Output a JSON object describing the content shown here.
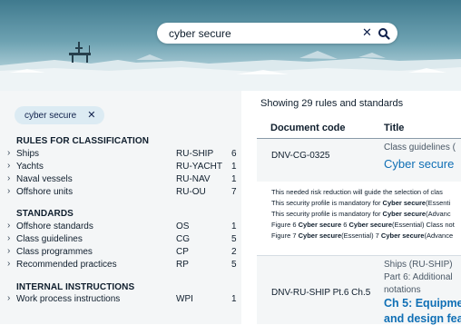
{
  "search": {
    "value": "cyber secure"
  },
  "chip": {
    "label": "cyber secure"
  },
  "groups": [
    {
      "title": "RULES FOR CLASSIFICATION",
      "items": [
        {
          "label": "Ships",
          "code": "RU-SHIP",
          "count": "6"
        },
        {
          "label": "Yachts",
          "code": "RU-YACHT",
          "count": "1"
        },
        {
          "label": "Naval vessels",
          "code": "RU-NAV",
          "count": "1"
        },
        {
          "label": "Offshore units",
          "code": "RU-OU",
          "count": "7"
        }
      ]
    },
    {
      "title": "STANDARDS",
      "items": [
        {
          "label": "Offshore standards",
          "code": "OS",
          "count": "1"
        },
        {
          "label": "Class guidelines",
          "code": "CG",
          "count": "5"
        },
        {
          "label": "Class programmes",
          "code": "CP",
          "count": "2"
        },
        {
          "label": "Recommended practices",
          "code": "RP",
          "count": "5"
        }
      ]
    },
    {
      "title": "INTERNAL INSTRUCTIONS",
      "items": [
        {
          "label": "Work process instructions",
          "code": "WPI",
          "count": "1"
        }
      ]
    }
  ],
  "results": {
    "showing": "Showing 29 rules and standards",
    "col_code": "Document code",
    "col_title": "Title",
    "r1": {
      "code": "DNV-CG-0325",
      "category": "Class guidelines (",
      "title": "Cyber secure",
      "snippets": [
        [
          "This needed risk reduction will guide the selection of clas",
          "",
          "",
          "",
          ""
        ],
        [
          "This security profile is mandatory for ",
          "Cyber secure",
          "(Essenti",
          "",
          ""
        ],
        [
          "This security profile is mandatory for ",
          "Cyber secure",
          "(Advanc",
          "",
          ""
        ],
        [
          "Figure 6 ",
          "Cyber secure",
          " 6 ",
          "Cyber secure",
          "(Essential) Class not"
        ],
        [
          "Figure 7 ",
          "Cyber secure",
          "(Essential) 7 ",
          "Cyber secure",
          "(Advance"
        ]
      ]
    },
    "r2": {
      "code": "DNV-RU-SHIP Pt.6 Ch.5",
      "category": "Ships (RU-SHIP)",
      "part": "Part 6: Additional",
      "part2": "notations",
      "title": "Ch 5: Equipmen",
      "title2": "and design feat"
    }
  },
  "colors": {
    "accent": "#0f6fb5",
    "panel": "#f4f6f7",
    "chip": "#dcebf3",
    "navy": "#0f204b"
  }
}
